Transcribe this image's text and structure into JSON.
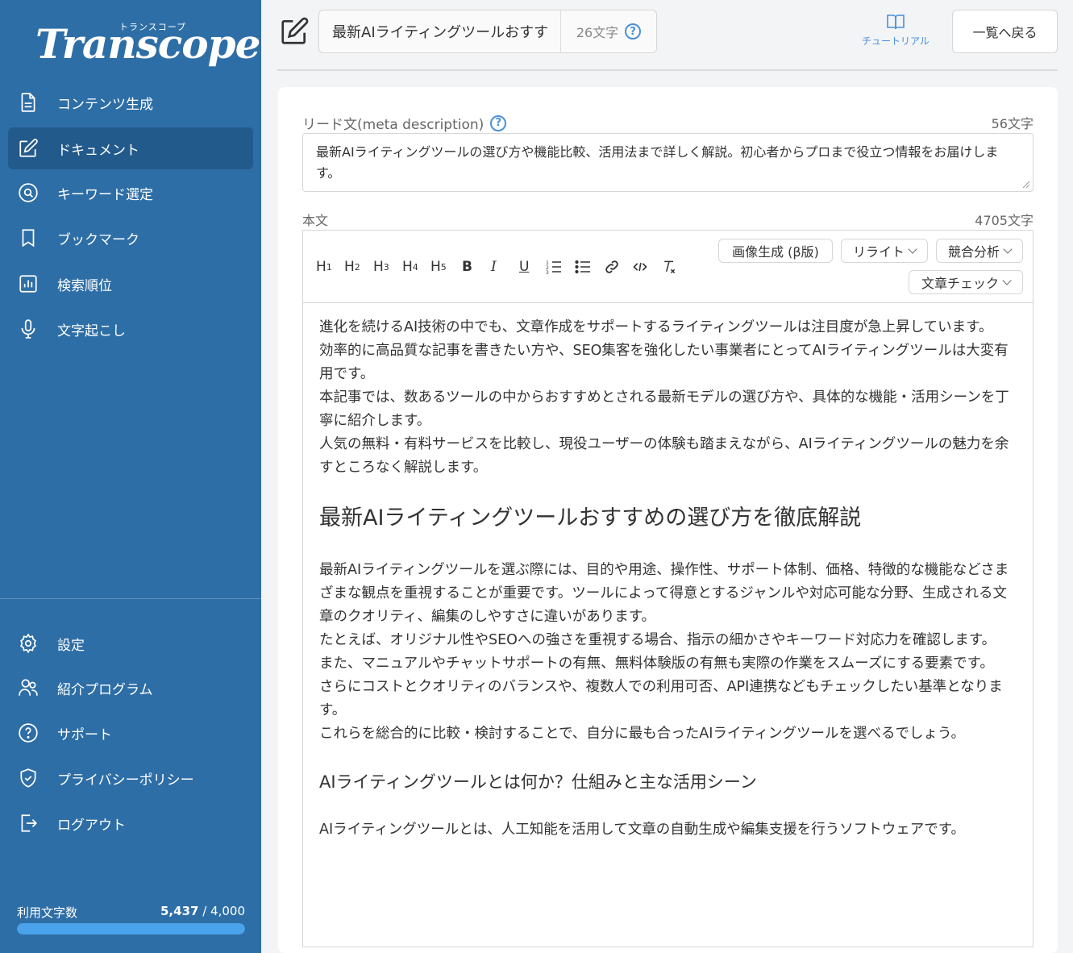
{
  "app": {
    "logo_text": "Transcope",
    "logo_kana": "トランスコープ"
  },
  "sidebar": {
    "items": [
      {
        "label": "コンテンツ生成",
        "icon": "document-icon"
      },
      {
        "label": "ドキュメント",
        "icon": "edit-icon",
        "active": true
      },
      {
        "label": "キーワード選定",
        "icon": "search-circle-icon"
      },
      {
        "label": "ブックマーク",
        "icon": "bookmark-icon"
      },
      {
        "label": "検索順位",
        "icon": "bar-chart-icon"
      },
      {
        "label": "文字起こし",
        "icon": "microphone-icon"
      }
    ],
    "bottom_items": [
      {
        "label": "設定",
        "icon": "gear-icon"
      },
      {
        "label": "紹介プログラム",
        "icon": "users-icon"
      },
      {
        "label": "サポート",
        "icon": "question-icon"
      },
      {
        "label": "プライバシーポリシー",
        "icon": "shield-icon"
      },
      {
        "label": "ログアウト",
        "icon": "logout-icon"
      }
    ],
    "usage": {
      "label": "利用文字数",
      "used": "5,437",
      "limit": "/ 4,000",
      "fill_fraction": 1.0
    }
  },
  "header": {
    "title_value": "最新AIライティングツールおすすめ",
    "title_count": "26文字",
    "tutorial_label": "チュートリアル",
    "back_label": "一覧へ戻る"
  },
  "meta": {
    "label": "リード文(meta description)",
    "count": "56文字",
    "text": "最新AIライティングツールの選び方や機能比較、活用法まで詳しく解説。初心者からプロまで役立つ情報をお届けします。"
  },
  "body": {
    "label": "本文",
    "count": "4705文字",
    "toolbar": {
      "image_gen": "画像生成 (β版)",
      "rewrite": "リライト",
      "competitor": "競合分析",
      "check": "文章チェック"
    },
    "intro": [
      "進化を続けるAI技術の中でも、文章作成をサポートするライティングツールは注目度が急上昇しています。",
      "効率的に高品質な記事を書きたい方や、SEO集客を強化したい事業者にとってAIライティングツールは大変有用です。",
      "本記事では、数あるツールの中からおすすめとされる最新モデルの選び方や、具体的な機能・活用シーンを丁寧に紹介します。",
      "人気の無料・有料サービスを比較し、現役ユーザーの体験も踏まえながら、AIライティングツールの魅力を余すところなく解説します。"
    ],
    "heading1": "最新AIライティングツールおすすめの選び方を徹底解説",
    "section1": [
      "最新AIライティングツールを選ぶ際には、目的や用途、操作性、サポート体制、価格、特徴的な機能などさまざまな観点を重視することが重要です。ツールによって得意とするジャンルや対応可能な分野、生成される文章のクオリティ、編集のしやすさに違いがあります。",
      "たとえば、オリジナル性やSEOへの強さを重視する場合、指示の細かさやキーワード対応力を確認します。",
      "また、マニュアルやチャットサポートの有無、無料体験版の有無も実際の作業をスムーズにする要素です。",
      "さらにコストとクオリティのバランスや、複数人での利用可否、API連携などもチェックしたい基準となります。",
      "これらを総合的に比較・検討することで、自分に最も合ったAIライティングツールを選べるでしょう。"
    ],
    "heading2": "AIライティングツールとは何か？仕組みと主な活用シーン",
    "section2": [
      "AIライティングツールとは、人工知能を活用して文章の自動生成や編集支援を行うソフトウェアです。"
    ]
  }
}
